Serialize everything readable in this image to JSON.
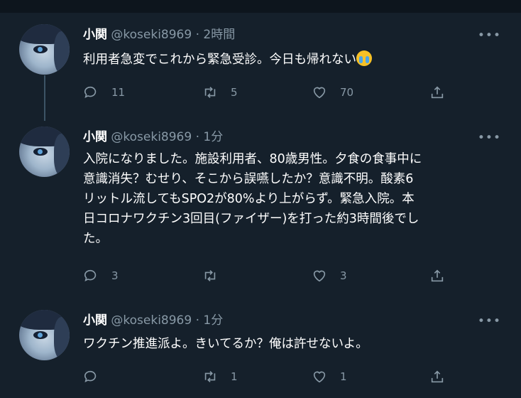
{
  "tweets": [
    {
      "name": "小関",
      "handle": "@koseki8969",
      "time": "2時間",
      "text": "利用者急変でこれから緊急受診。今日も帰れない",
      "emoji": "loudly-crying-face-emoji",
      "reply_count": "11",
      "retweet_count": "5",
      "like_count": "70"
    },
    {
      "name": "小関",
      "handle": "@koseki8969",
      "time": "1分",
      "text": "入院になりました。施設利用者、80歳男性。夕食の食事中に\n意識消失？むせり、そこから誤嚥したか？意識不明。酸素6\nリットル流してもSPO2が80%より上がらず。緊急入院。本\n日コロナワクチン3回目(ファイザー)を打った約3時間後でし\nた。",
      "reply_count": "3",
      "retweet_count": "",
      "like_count": "3"
    },
    {
      "name": "小関",
      "handle": "@koseki8969",
      "time": "1分",
      "text": "ワクチン推進派よ。きいてるか？俺は許せないよ。",
      "reply_count": "",
      "retweet_count": "1",
      "like_count": "1"
    }
  ],
  "dot": "·",
  "more": "•••"
}
